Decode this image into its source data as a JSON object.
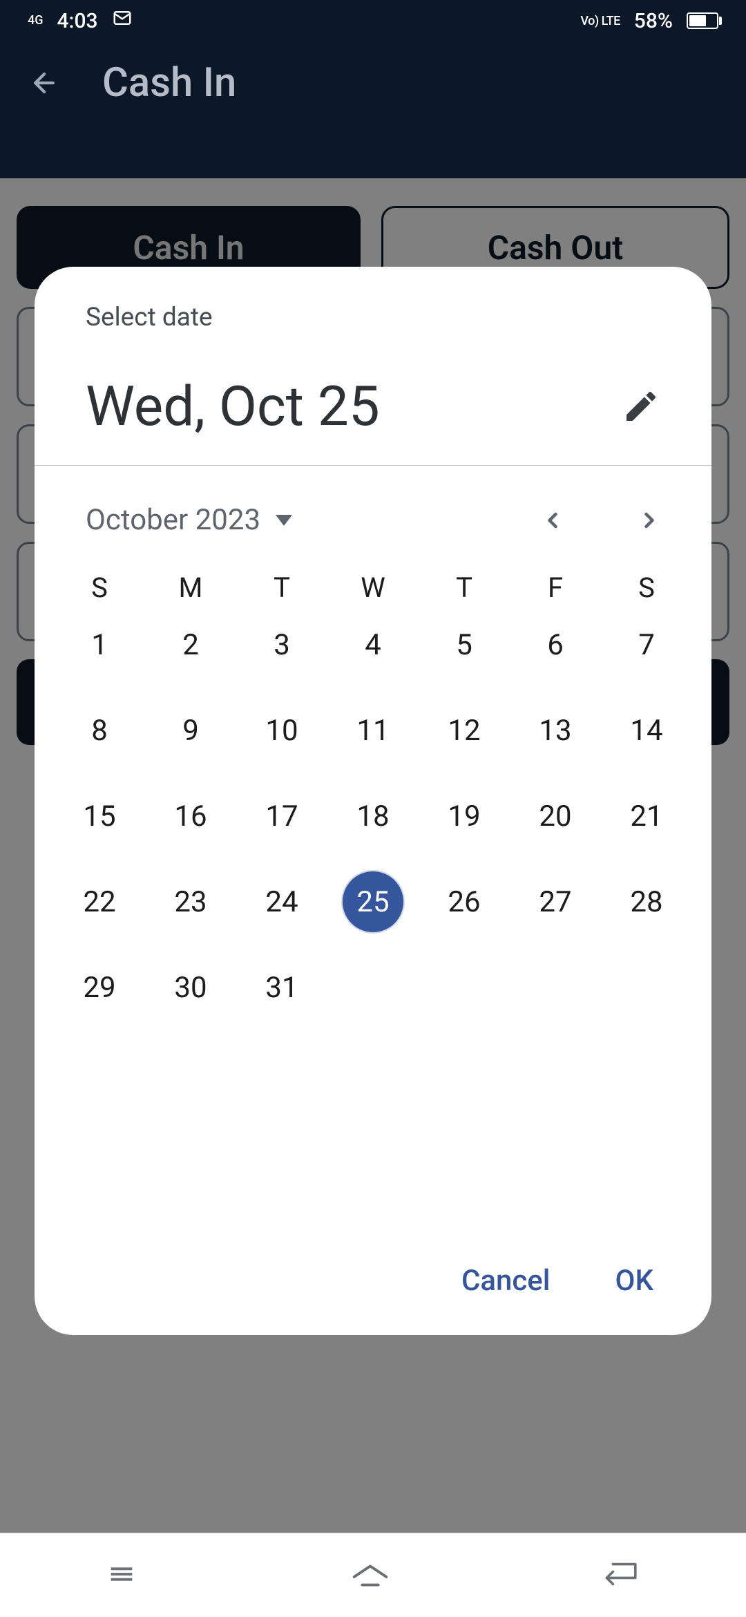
{
  "status_bar": {
    "network": "4G",
    "time": "4:03",
    "volte": "Vo) LTE",
    "battery_pct": "58%"
  },
  "header": {
    "title": "Cash In"
  },
  "tabs": {
    "cash_in": "Cash In",
    "cash_out": "Cash Out"
  },
  "dialog": {
    "subtitle": "Select date",
    "selected_date_display": "Wed, Oct 25",
    "month_label": "October 2023",
    "dow": [
      "S",
      "M",
      "T",
      "W",
      "T",
      "F",
      "S"
    ],
    "days": [
      1,
      2,
      3,
      4,
      5,
      6,
      7,
      8,
      9,
      10,
      11,
      12,
      13,
      14,
      15,
      16,
      17,
      18,
      19,
      20,
      21,
      22,
      23,
      24,
      25,
      26,
      27,
      28,
      29,
      30,
      31
    ],
    "selected_day": 25,
    "cancel": "Cancel",
    "ok": "OK"
  }
}
